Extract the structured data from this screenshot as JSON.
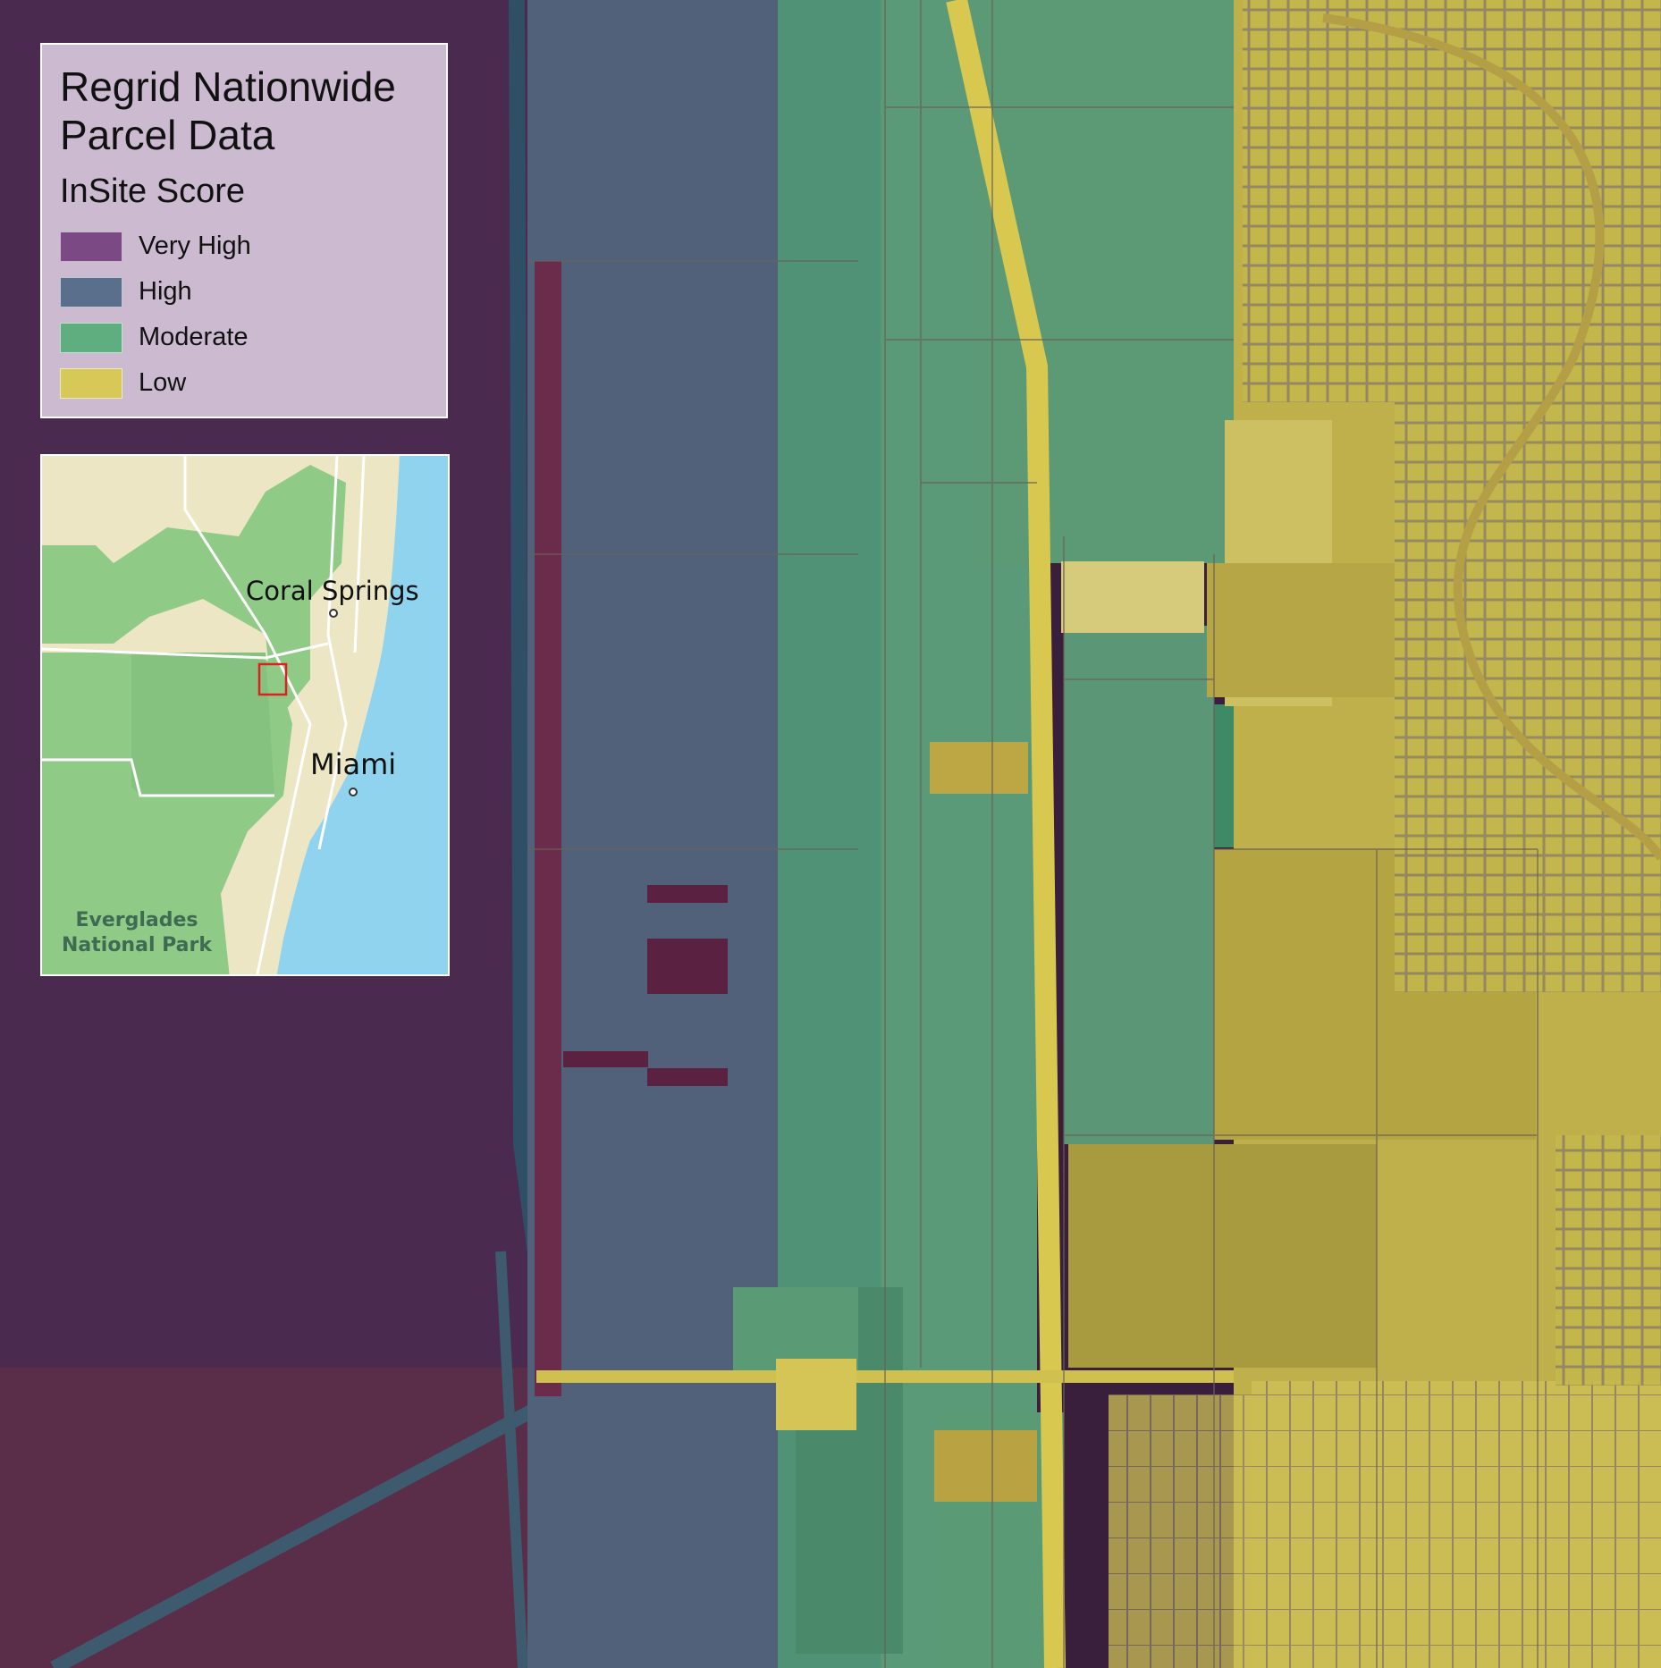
{
  "legend": {
    "title": "Regrid Nationwide Parcel Data",
    "subtitle": "InSite Score",
    "items": [
      {
        "label": "Very High",
        "color": "#7b4a85"
      },
      {
        "label": "High",
        "color": "#5a6f8c"
      },
      {
        "label": "Moderate",
        "color": "#5fae80"
      },
      {
        "label": "Low",
        "color": "#d7c957"
      }
    ]
  },
  "inset": {
    "cities": [
      {
        "name": "Coral Springs"
      },
      {
        "name": "Miami"
      }
    ],
    "park": "Everglades\nNational Park",
    "colors": {
      "water": "#8fd3ee",
      "urban": "#ede6c4",
      "green": "#8fcb86",
      "highlight": "#e02020"
    }
  }
}
